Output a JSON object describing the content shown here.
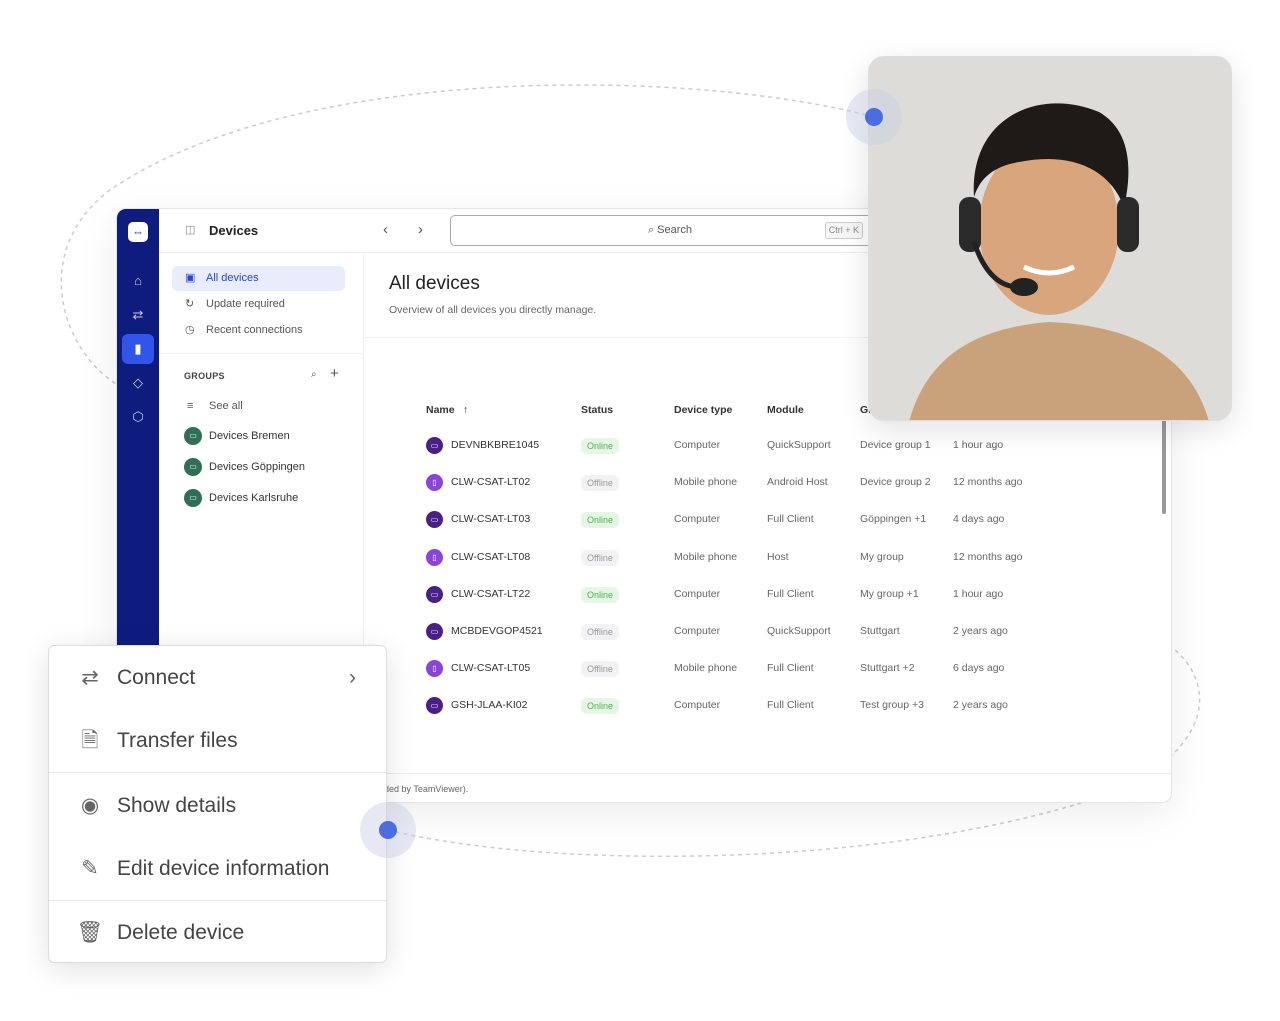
{
  "app": {
    "title": "Devices",
    "search_placeholder": "Search",
    "search_shortcut": "Ctrl + K"
  },
  "nav": {
    "items": [
      {
        "label": "All devices",
        "icon": "devices-icon",
        "active": true
      },
      {
        "label": "Update required",
        "icon": "update-icon"
      },
      {
        "label": "Recent connections",
        "icon": "stopwatch-icon"
      }
    ],
    "groups_header": "GROUPS",
    "see_all": "See all",
    "groups": [
      "Devices Bremen",
      "Devices Göppingen",
      "Devices Karlsruhe"
    ]
  },
  "main": {
    "title": "All devices",
    "subtitle": "Overview of all devices you directly manage.",
    "footer": "ded by TeamViewer)."
  },
  "table": {
    "headers": [
      "Name",
      "Status",
      "Device type",
      "Module",
      "Gr",
      ""
    ],
    "rows": [
      {
        "name": "DEVNBKBRE1045",
        "status": "Online",
        "type": "Computer",
        "module": "QuickSupport",
        "group": "Device group 1",
        "last": "1 hour ago"
      },
      {
        "name": "CLW-CSAT-LT02",
        "status": "Offline",
        "type": "Mobile phone",
        "module": "Android Host",
        "group": "Device group 2",
        "last": "12 months ago"
      },
      {
        "name": "CLW-CSAT-LT03",
        "status": "Online",
        "type": "Computer",
        "module": "Full Client",
        "group": "Göppingen +1",
        "last": "4 days ago"
      },
      {
        "name": "CLW-CSAT-LT08",
        "status": "Offline",
        "type": "Mobile phone",
        "module": "Host",
        "group": "My group",
        "last": "12 months ago"
      },
      {
        "name": "CLW-CSAT-LT22",
        "status": "Online",
        "type": "Computer",
        "module": "Full Client",
        "group": "My group +1",
        "last": "1 hour ago"
      },
      {
        "name": "MCBDEVGOP4521",
        "status": "Offline",
        "type": "Computer",
        "module": "QuickSupport",
        "group": "Stuttgart",
        "last": "2 years ago"
      },
      {
        "name": "CLW-CSAT-LT05",
        "status": "Offline",
        "type": "Mobile phone",
        "module": "Full Client",
        "group": "Stuttgart +2",
        "last": "6 days ago"
      },
      {
        "name": "GSH-JLAA-KI02",
        "status": "Online",
        "type": "Computer",
        "module": "Full Client",
        "group": "Test group +3",
        "last": "2 years ago"
      }
    ]
  },
  "context_menu": {
    "items": [
      "Connect",
      "Transfer files",
      "Show details",
      "Edit device information",
      "Delete device"
    ]
  },
  "colors": {
    "rail": "#0e1c7e",
    "accent": "#3155e8",
    "online": "#4fb34f",
    "computer": "#4a1f86",
    "mobile": "#8a45d6",
    "group": "#2f6e57"
  }
}
